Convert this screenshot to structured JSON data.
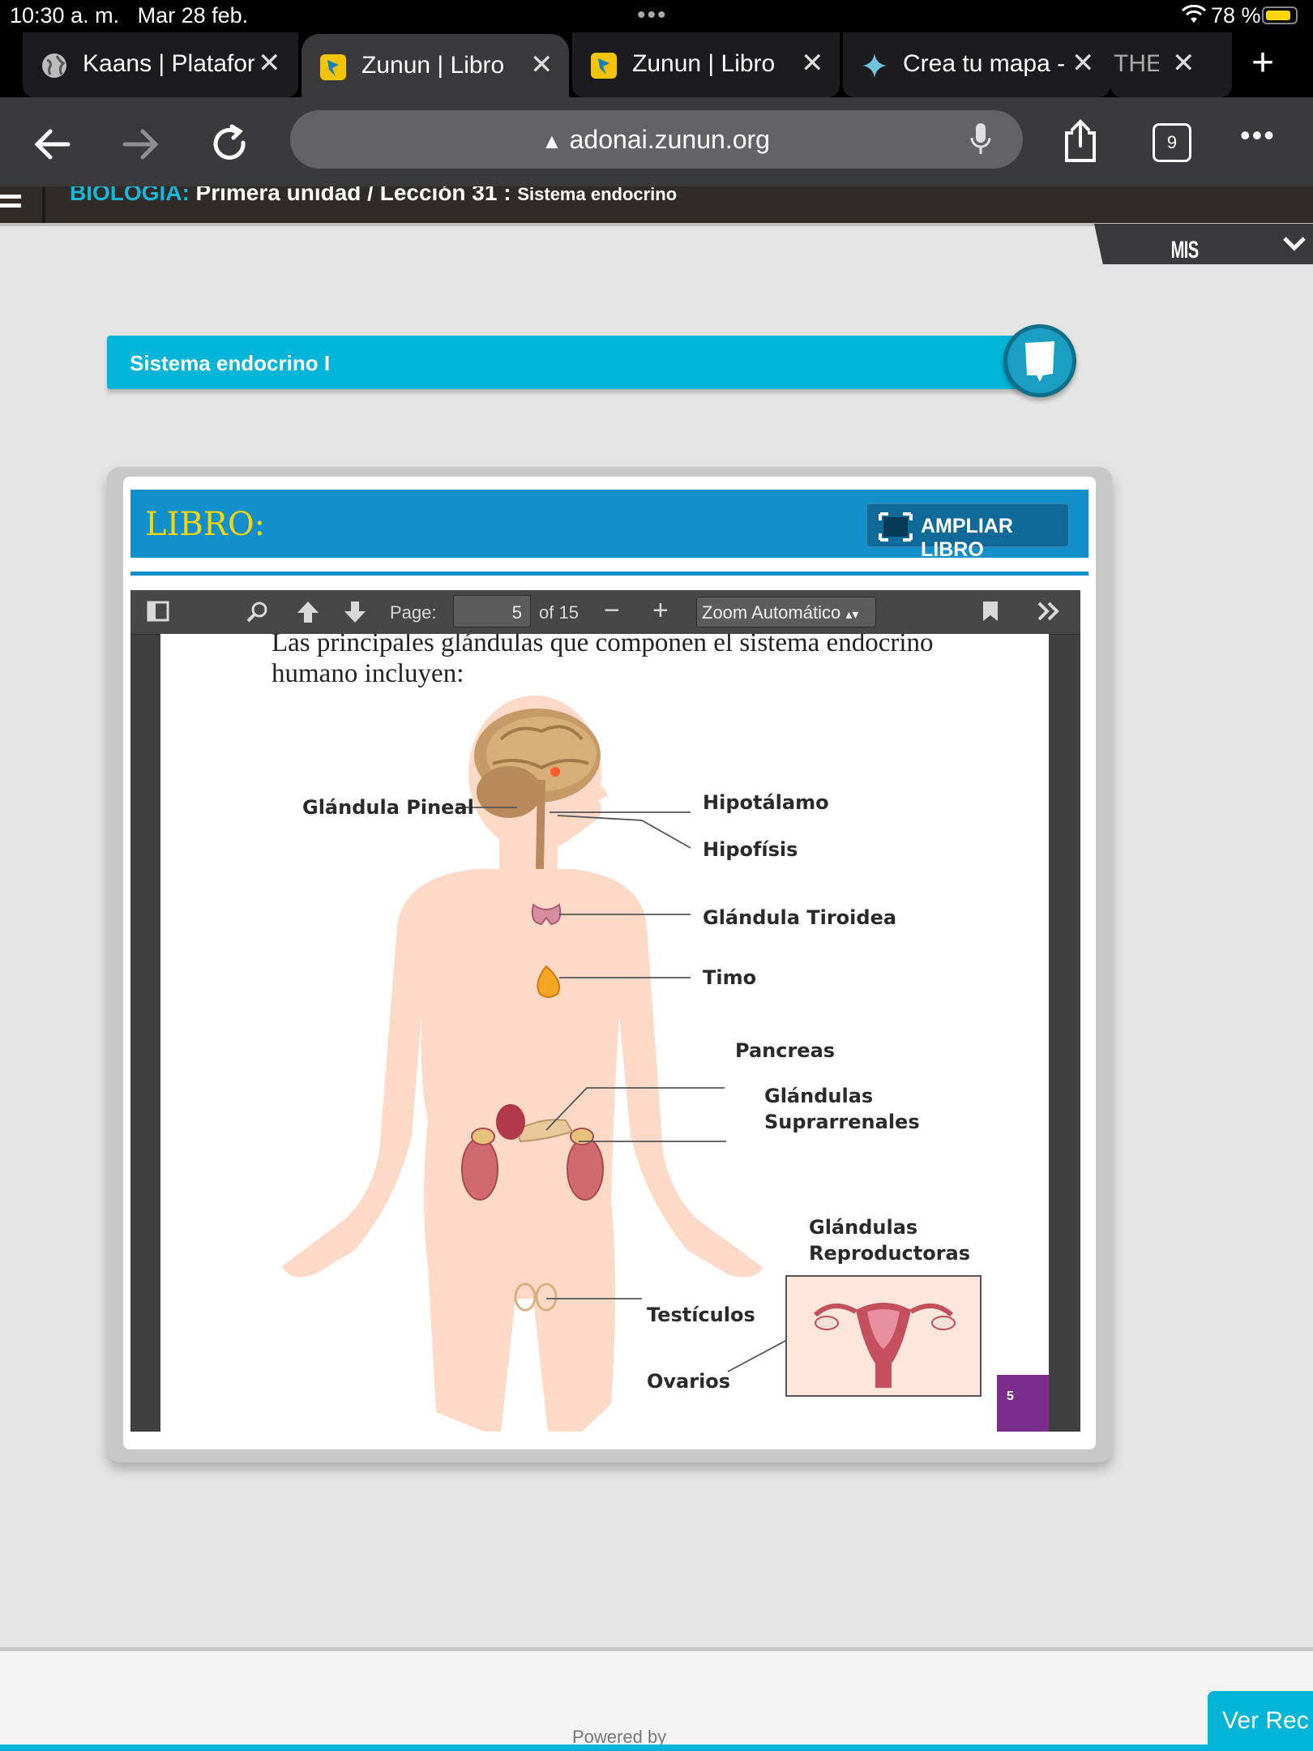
{
  "status_bar": {
    "time": "10:30 a. m.",
    "date": "Mar 28 feb.",
    "battery": "78 %"
  },
  "tabs": [
    {
      "label": "Kaans | Platafor",
      "state": "inactive"
    },
    {
      "label": "Zunun | Libro",
      "state": "active"
    },
    {
      "label": "Zunun | Libro",
      "state": "inactive"
    },
    {
      "label": "Crea tu mapa -",
      "state": "inactive"
    },
    {
      "label": "THE",
      "state": "inactive"
    }
  ],
  "address_bar": {
    "url": "adonai.zunun.org",
    "tab_count": "9"
  },
  "lesson_header": {
    "subject": "BIOLOGIA:",
    "path": "Primera unidad / Lección 31 :",
    "lesson": "Sistema endocrino"
  },
  "mis_materias": "MIS MATERIAS",
  "banner": {
    "title": "Sistema endocrino I"
  },
  "libro": {
    "label": "LIBRO:",
    "ampliar": "AMPLIAR LIBRO"
  },
  "pdf_toolbar": {
    "page_label": "Page:",
    "page_value": "5",
    "of_label": "of 15",
    "zoom": "Zoom Automático"
  },
  "pdf_page": {
    "intro_line1": "Las principales glándulas que componen el sistema endocrino",
    "intro_line2": "humano incluyen:",
    "labels": {
      "pineal": "Glándula Pineal",
      "hipotalamo": "Hipotálamo",
      "hipofisis": "Hipofísis",
      "tiroidea": "Glándula Tiroidea",
      "timo": "Timo",
      "pancreas": "Pancreas",
      "suprarrenales_1": "Glándulas",
      "suprarrenales_2": "Suprarrenales",
      "reproductoras_1": "Glándulas",
      "reproductoras_2": "Reproductoras",
      "testiculos": "Testículos",
      "ovarios": "Ovarios"
    },
    "page_number": "5"
  },
  "footer": {
    "powered_by": "Powered by",
    "cta": "Ver Rec"
  }
}
